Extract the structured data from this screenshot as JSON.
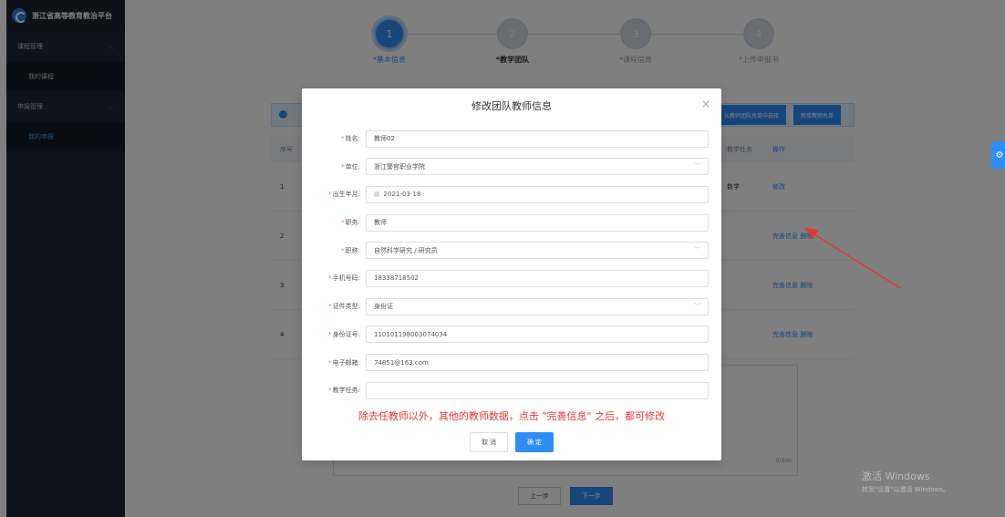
{
  "app": {
    "title": "浙江省高等教育教治平台"
  },
  "sidebar": {
    "groups": [
      {
        "label": "课程管理",
        "items": [
          {
            "label": "我的课程"
          }
        ]
      },
      {
        "label": "申报管理",
        "items": [
          {
            "label": "我的申报"
          }
        ]
      }
    ]
  },
  "steps": [
    {
      "number": "1",
      "label": "*基本信息"
    },
    {
      "number": "2",
      "label": "*教学团队"
    },
    {
      "number": "3",
      "label": "*课程信息"
    },
    {
      "number": "4",
      "label": "*上传申报书"
    }
  ],
  "toolbar": {
    "import_label": "从教师团队名单中选择",
    "add_label": "新增教师名单"
  },
  "table": {
    "headers": {
      "no": "序号",
      "task": "教学任务",
      "op": "操作"
    },
    "rows": [
      {
        "no": "1",
        "task": "数学",
        "op1": "修改",
        "op2": ""
      },
      {
        "no": "2",
        "task": "",
        "op1": "完善信息",
        "op2": "删除"
      },
      {
        "no": "3",
        "task": "",
        "op1": "完善信息",
        "op2": "删除"
      },
      {
        "no": "4",
        "task": "",
        "op1": "完善信息",
        "op2": "删除"
      }
    ]
  },
  "textarea": {
    "counter": "0/300"
  },
  "footer": {
    "prev_label": "上一步",
    "next_label": "下一步"
  },
  "watermark": {
    "line1": "激活 Windows",
    "line2": "转到\"设置\"以激活 Windows。"
  },
  "modal": {
    "title": "修改团队教师信息",
    "fields": {
      "name": {
        "label": "姓名:",
        "value": "教师02"
      },
      "unit": {
        "label": "单位:",
        "value": "浙江警官职业学院"
      },
      "birth": {
        "label": "出生年月:",
        "value": "2021-03-18"
      },
      "position": {
        "label": "职务:",
        "value": "教师"
      },
      "title": {
        "label": "职称:",
        "value": "自然科学研究 / 研究员"
      },
      "phone": {
        "label": "手机号码:",
        "value": "18338718502"
      },
      "id_type": {
        "label": "证件类型:",
        "value": "身份证"
      },
      "id_no": {
        "label": "身份证号:",
        "value": "110101198003074034"
      },
      "email": {
        "label": "电子邮箱:",
        "value": "74851@163.com"
      },
      "task": {
        "label": "教学任务:",
        "value": ""
      }
    },
    "note": "除去任教师以外，其他的教师数据，点击 \"完善信息\" 之后，都可修改",
    "cancel_label": "取 消",
    "ok_label": "确 定"
  },
  "colors": {
    "primary": "#2f8ef5",
    "sidebar": "#1e2736",
    "annotation": "#e53935"
  }
}
